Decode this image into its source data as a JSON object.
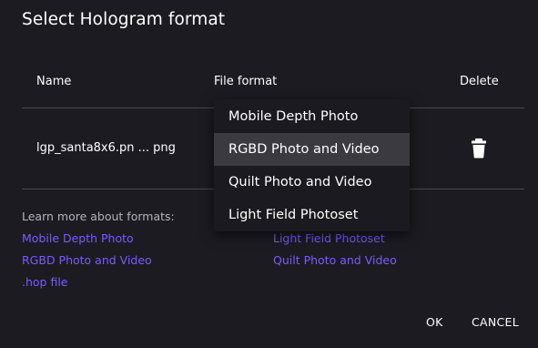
{
  "dialog": {
    "title": "Select Hologram format"
  },
  "table": {
    "columns": [
      "Name",
      "File format",
      "Delete"
    ],
    "rows": [
      {
        "name": "lgp_santa8x6.pn ... png"
      }
    ]
  },
  "format_menu": {
    "options": [
      "Mobile Depth Photo",
      "RGBD Photo and Video",
      "Quilt Photo and Video",
      "Light Field Photoset"
    ],
    "highlighted": "RGBD Photo and Video"
  },
  "learn_more": {
    "label": "Learn more about formats:",
    "links": {
      "mobile_depth_photo": "Mobile Depth Photo",
      "rgbd": "RGBD Photo and Video",
      "hop": ".hop file",
      "light_field": "Light Field Photoset",
      "quilt": "Quilt Photo and Video"
    }
  },
  "actions": {
    "ok_label": "OK",
    "cancel_label": "CANCEL"
  },
  "icons": {
    "delete": "trash-icon"
  },
  "colors": {
    "background": "#1c1b21",
    "link": "#7a5cff",
    "menu_highlight": "#3b3a41",
    "divider": "#4a4950"
  }
}
